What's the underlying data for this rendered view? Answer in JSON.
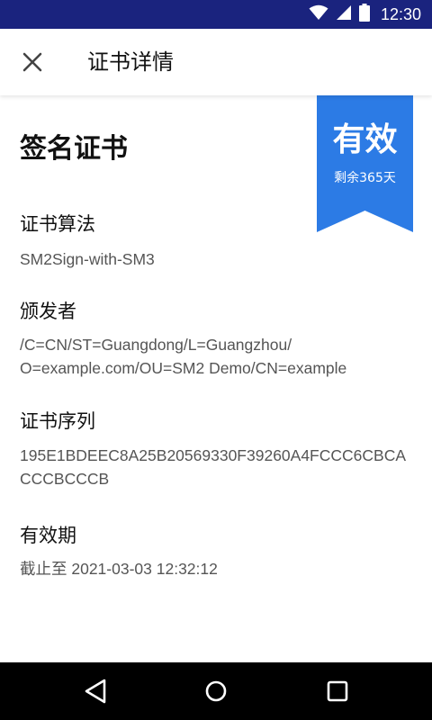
{
  "status_bar": {
    "time": "12:30",
    "icons": [
      "wifi-icon",
      "signal-icon",
      "battery-icon"
    ],
    "background": "#1a237e"
  },
  "app_bar": {
    "title": "证书详情",
    "close_icon": "close-icon"
  },
  "badge": {
    "title": "有效",
    "subtitle": "剩余365天",
    "color": "#2c7be5"
  },
  "certificate": {
    "heading": "签名证书",
    "fields": [
      {
        "label": "证书算法",
        "value": "SM2Sign-with-SM3"
      },
      {
        "label": "颁发者",
        "value": "/C=CN/ST=Guangdong/L=Guangzhou/\nO=example.com/OU=SM2 Demo/CN=example"
      },
      {
        "label": "证书序列",
        "value": "195E1BDEEC8A25B20569330F39260A4FCCC6CBCA\nCCCBCCCB"
      },
      {
        "label": "有效期",
        "value": "截止至 2021-03-03 12:32:12"
      }
    ]
  },
  "nav_bar": {
    "icons": [
      "back-icon",
      "home-icon",
      "recents-icon"
    ]
  }
}
